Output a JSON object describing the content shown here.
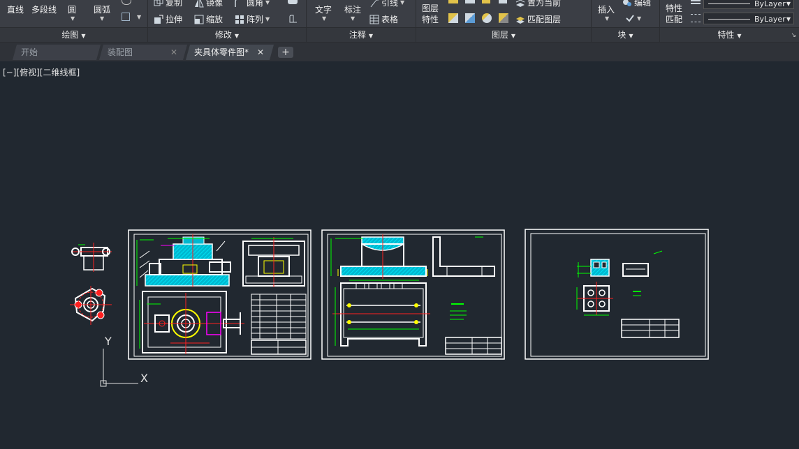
{
  "ribbon": {
    "draw": {
      "title": "绘图",
      "line": "直线",
      "polyline": "多段线",
      "circle": "圆",
      "arc": "圆弧"
    },
    "modify": {
      "title": "修改",
      "copy": "复制",
      "mirror": "镜像",
      "fillet": "圆角",
      "stretch": "拉伸",
      "scale": "缩放",
      "array": "阵列"
    },
    "annotation": {
      "title": "注释",
      "text": "文字",
      "dimension": "标注",
      "leader": "引线",
      "table": "表格"
    },
    "layers": {
      "title": "图层",
      "layer_properties_1": "图层",
      "layer_properties_2": "特性",
      "set_current": "置为当前",
      "match_layer": "匹配图层"
    },
    "block": {
      "title": "块",
      "insert": "插入",
      "edit": "编辑"
    },
    "properties": {
      "title": "特性",
      "match_1": "特性",
      "match_2": "匹配",
      "bylayer_1": "ByLayer",
      "bylayer_2": "ByLayer"
    }
  },
  "tabs": [
    {
      "label": "开始"
    },
    {
      "label": "装配图"
    },
    {
      "label": "夹具体零件图*"
    }
  ],
  "viewport": {
    "label": "[−][俯视][二维线框]"
  },
  "ucs": {
    "x": "X",
    "y": "Y"
  },
  "colors": {
    "canvas": "#212830",
    "ribbon": "#3b3e45",
    "cyan": "#00e5ff",
    "green": "#00ff00",
    "red": "#ff2020",
    "yellow": "#ffff00",
    "magenta": "#ff00ff"
  }
}
